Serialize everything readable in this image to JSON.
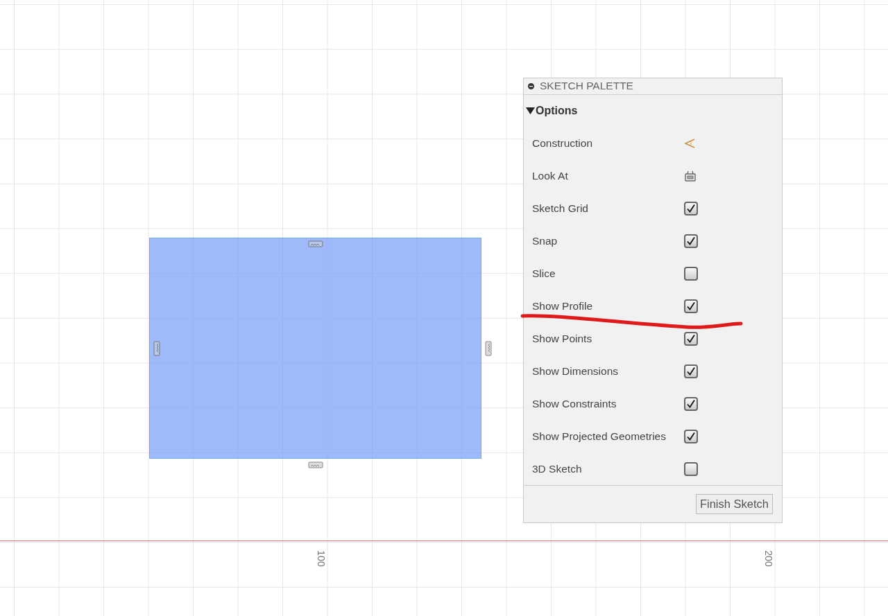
{
  "canvas": {
    "axis_labels": [
      "100",
      "200"
    ]
  },
  "palette": {
    "title": "SKETCH PALETTE",
    "section": {
      "label": "Options",
      "expanded": true
    },
    "options": [
      {
        "label": "Construction",
        "kind": "construction"
      },
      {
        "label": "Look At",
        "kind": "look-at"
      },
      {
        "label": "Sketch Grid",
        "kind": "checkbox",
        "checked": true
      },
      {
        "label": "Snap",
        "kind": "checkbox",
        "checked": true
      },
      {
        "label": "Slice",
        "kind": "checkbox",
        "checked": false
      },
      {
        "label": "Show Profile",
        "kind": "checkbox",
        "checked": true
      },
      {
        "label": "Show Points",
        "kind": "checkbox",
        "checked": true
      },
      {
        "label": "Show Dimensions",
        "kind": "checkbox",
        "checked": true
      },
      {
        "label": "Show Constraints",
        "kind": "checkbox",
        "checked": true
      },
      {
        "label": "Show Projected Geometries",
        "kind": "checkbox",
        "checked": true
      },
      {
        "label": "3D Sketch",
        "kind": "checkbox",
        "checked": false
      }
    ],
    "button": "Finish Sketch"
  }
}
